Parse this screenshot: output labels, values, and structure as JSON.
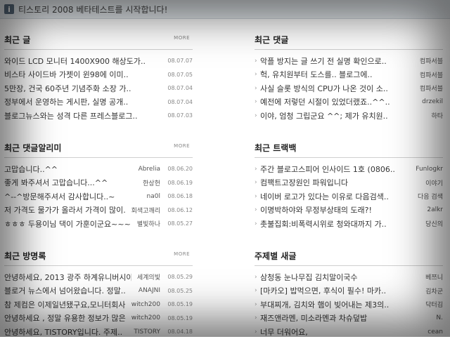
{
  "notice": {
    "icon": "info-icon",
    "text": "티스토리 2008 베타테스트를 시작합니다!"
  },
  "more_label": "MORE",
  "panels": {
    "recent_posts": {
      "title": "최근 글",
      "items": [
        {
          "text": "와이드 LCD 모니터 1400X900 해상도가..",
          "date": "08.07.07"
        },
        {
          "text": "비스타 사이드바 가젯이 윈98에 이미..",
          "date": "08.07.05"
        },
        {
          "text": "5만장, 건국 60주년 기념주화 소장 가..",
          "date": "08.07.04"
        },
        {
          "text": "정부에서 운영하는 게시판, 실명 공개..",
          "date": "08.07.04"
        },
        {
          "text": "블로그뉴스와는 성격 다른 프레스블로그..",
          "date": "08.07.03"
        }
      ]
    },
    "recent_comments": {
      "title": "최근 댓글",
      "items": [
        {
          "text": "악플 방지는 글 쓰기 전 실명 확인으로..",
          "author": "컴파서블"
        },
        {
          "text": "헉, 유치원부터 도스를.. 블로그에..",
          "author": "컴파서블"
        },
        {
          "text": "사실 슬롯 방식의 CPU가 나온 것이 소..",
          "author": "컴파서블"
        },
        {
          "text": "예전에 저렇던 시절이 있었더랬죠..^^..",
          "author": "drzekil"
        },
        {
          "text": "이야, 엄청 그립군요 ^^; 제가 유치원..",
          "author": "하타"
        }
      ]
    },
    "comment_notify": {
      "title": "최근 댓글알리미",
      "items": [
        {
          "text": "고맙습니다..^^",
          "author": "Abrelia",
          "date": "08.06.20"
        },
        {
          "text": "좋게 봐주셔서 고맙습니다...^^",
          "author": "한상헌",
          "date": "08.06.19"
        },
        {
          "text": "^--^방문해주셔서 감사합니다..~",
          "author": "na0l",
          "date": "08.06.18"
        },
        {
          "text": "저 가격도 물가가 올라서 가격이 많이..",
          "author": "회색고깨리",
          "date": "08.06.12"
        },
        {
          "text": "ㅎㅎㅎ 두용이님 댁이 가훈이군요~~~..",
          "author": "별빛하나",
          "date": "08.05.27"
        }
      ]
    },
    "trackbacks": {
      "title": "최근 트랙백",
      "items": [
        {
          "text": "주간 블로고스피어 인사이드 1호 (0806..",
          "author": "Funlogkr"
        },
        {
          "text": "컴팩트고장원인 파워입니다",
          "author": "이야기"
        },
        {
          "text": "네이버 로고가 있다는 이유로 다음검색..",
          "author": "다음 검색"
        },
        {
          "text": "이명박하야와 무정부상태의 도래?!",
          "author": "2alkr"
        },
        {
          "text": "촛불집회:비폭력시위로 청와대까지 가..",
          "author": "당신의"
        }
      ]
    },
    "guestbook": {
      "title": "최근 방명록",
      "items": [
        {
          "text": "안녕하세요, 2013 광주 하계유니버시아..",
          "author": "세계의빛",
          "date": "08.05.29"
        },
        {
          "text": "블로거 뉴스에서 넘어왔습니다. 정말..",
          "author": "ANAJNI",
          "date": "08.05.25"
        },
        {
          "text": "참 제컴은 이제일년됐구요,모니터회사..",
          "author": "witch200",
          "date": "08.05.19"
        },
        {
          "text": "안녕하세요 , 정말 유용한 정보가 많은..",
          "author": "witch200",
          "date": "08.05.19"
        },
        {
          "text": "안녕하세요, TISTORY입니다. 주제..",
          "author": "TISTORY",
          "date": "08.04.18"
        }
      ]
    },
    "topic_posts": {
      "title": "주제별 새글",
      "items": [
        {
          "text": "삼청동 눈나무집 김치말이국수",
          "author": "베쯔니"
        },
        {
          "text": "[마카오] 밥먹으면, 후식이 필수! 마카..",
          "author": "김차군"
        },
        {
          "text": "부대찌개, 김치와 햄이 빚어내는 제3의..",
          "author": "닥터김"
        },
        {
          "text": "재즈앤라멘, 미소라멘과 차슈덮밥",
          "author": "N."
        },
        {
          "text": "너무 더워어요,",
          "author": "cean"
        }
      ]
    }
  }
}
